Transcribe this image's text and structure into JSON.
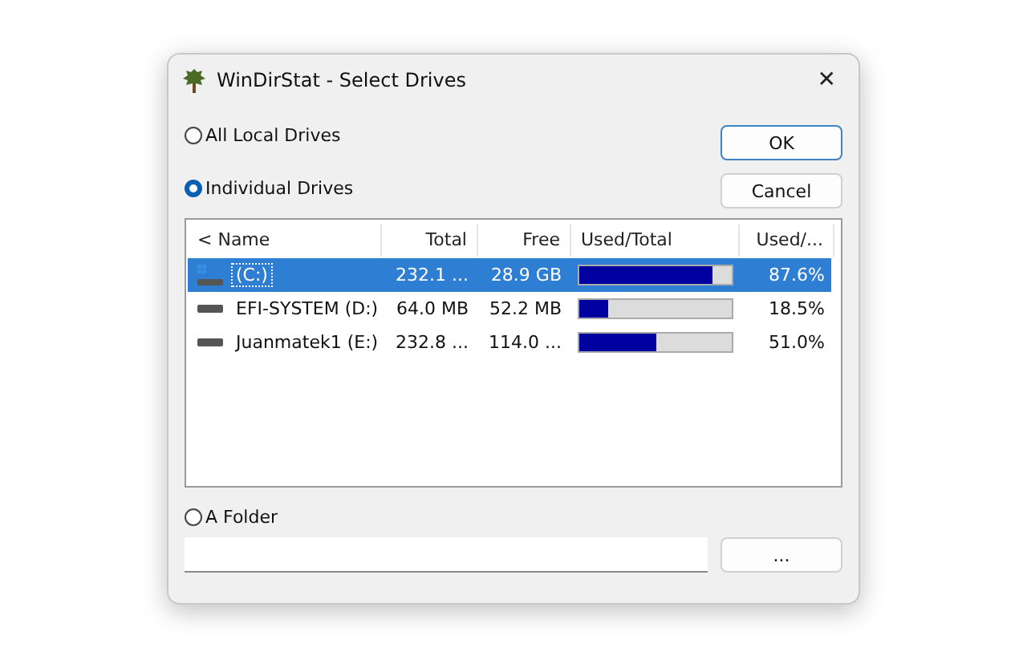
{
  "window": {
    "title": "WinDirStat - Select Drives",
    "close": "✕"
  },
  "options": [
    {
      "label": "All Local Drives",
      "selected": false
    },
    {
      "label": "Individual Drives",
      "selected": true
    },
    {
      "label": "A Folder",
      "selected": false
    }
  ],
  "buttons": [
    {
      "label": "OK",
      "default": true
    },
    {
      "label": "Cancel",
      "default": false
    }
  ],
  "table": {
    "columns": [
      "< Name",
      "Total",
      "Free",
      "Used/Total",
      "Used/..."
    ],
    "rows": [
      {
        "kind": "system",
        "name": "(C:)",
        "total": "232.1 ...",
        "free": "28.9 GB",
        "level": 0.876,
        "used": "87.6%",
        "selected": true
      },
      {
        "kind": "drive",
        "name": "EFI-SYSTEM (D:)",
        "total": "64.0 MB",
        "free": "52.2 MB",
        "level": 0.185,
        "used": "18.5%",
        "selected": false
      },
      {
        "kind": "drive",
        "name": "Juanmatek1 (E:)",
        "total": "232.8 ...",
        "free": "114.0 ...",
        "level": 0.51,
        "used": "51.0%",
        "selected": false
      }
    ]
  },
  "browse_button": "..."
}
